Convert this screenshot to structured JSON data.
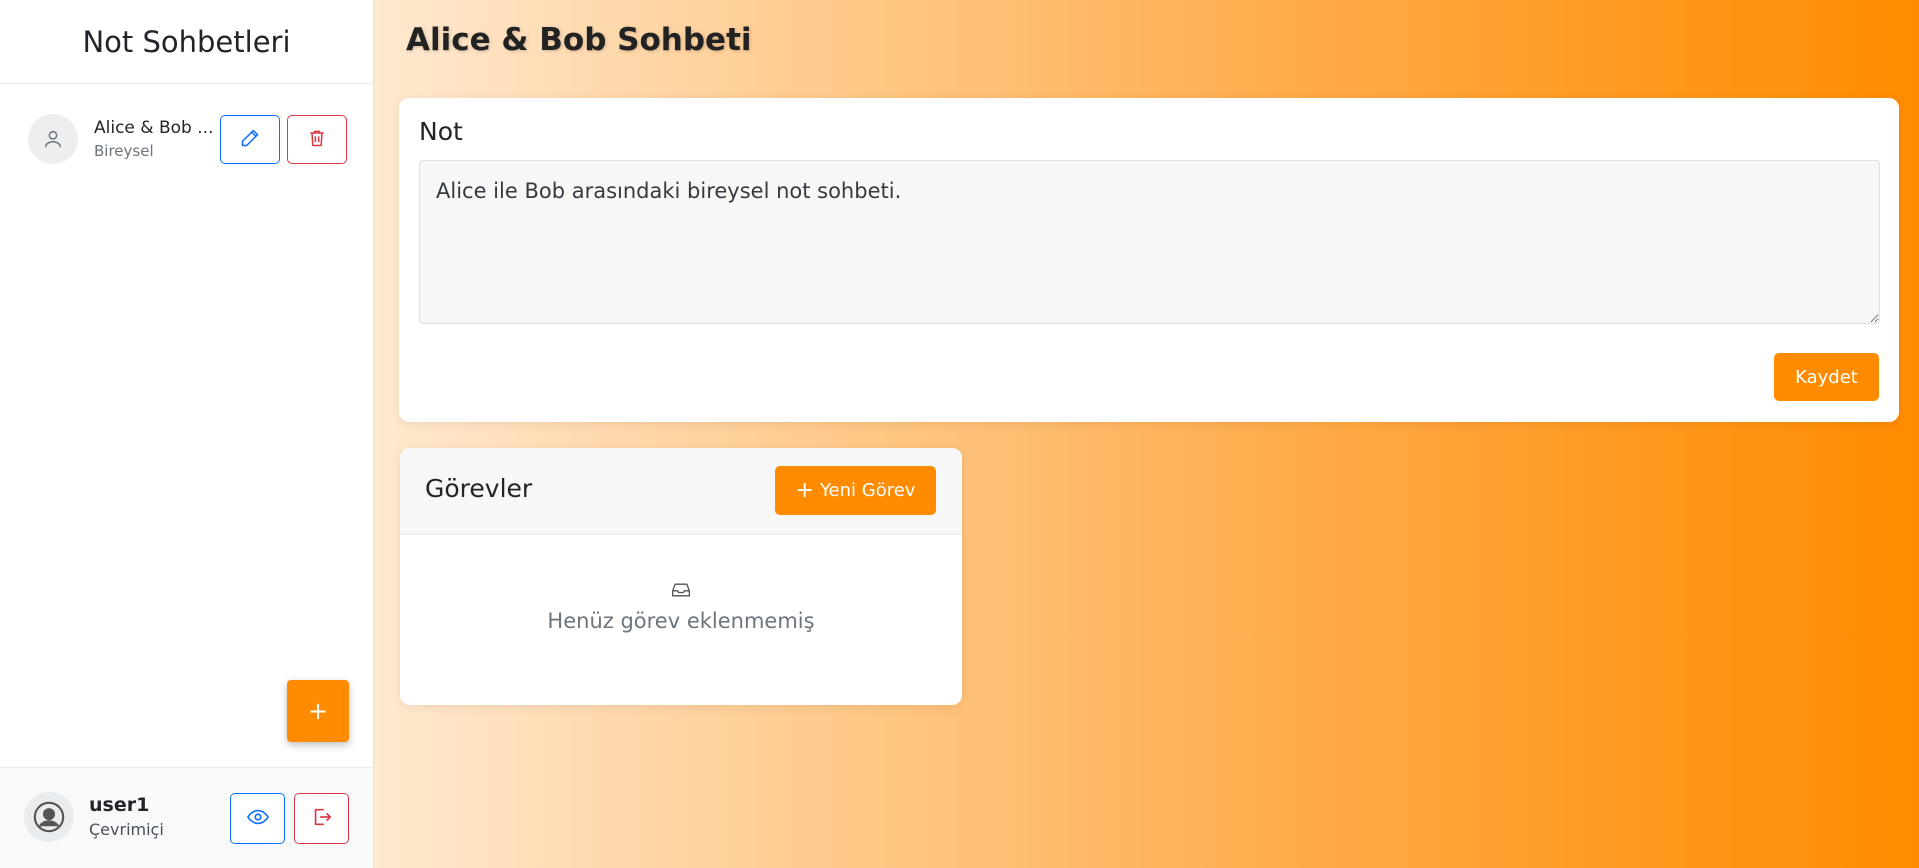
{
  "sidebar": {
    "title": "Not Sohbetleri",
    "chats": [
      {
        "name": "Alice & Bob ...",
        "type": "Bireysel"
      }
    ],
    "add_button_label": "+"
  },
  "user": {
    "name": "user1",
    "status": "Çevrimiçi"
  },
  "main": {
    "title": "Alice & Bob Sohbeti",
    "note": {
      "label": "Not",
      "content": "Alice ile Bob arasındaki bireysel not sohbeti.",
      "save_label": "Kaydet"
    },
    "tasks": {
      "title": "Görevler",
      "new_task_label": "Yeni Görev",
      "new_task_icon": "+",
      "empty_text": "Henüz görev eklenmemiş"
    }
  },
  "colors": {
    "accent": "#ff8c00",
    "primary_outline": "#0d6efd",
    "danger_outline": "#dc3545"
  },
  "icons": [
    "user-icon",
    "pencil-icon",
    "trash-icon",
    "eye-icon",
    "logout-icon",
    "inbox-icon",
    "user-circle-icon"
  ]
}
